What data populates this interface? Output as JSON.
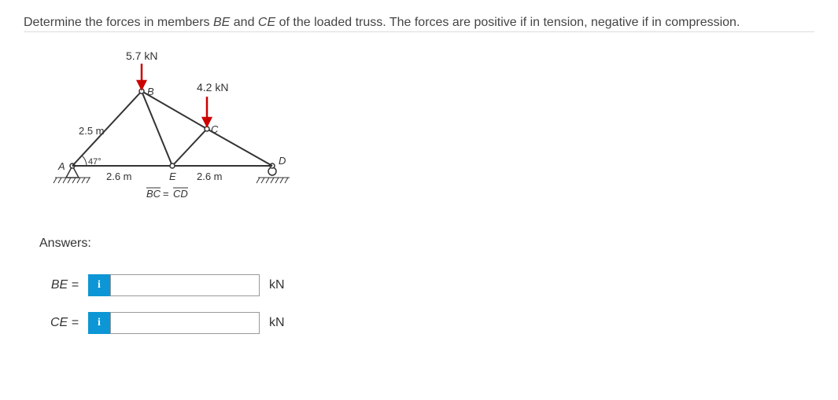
{
  "problem": {
    "text_prefix": "Determine the forces in members ",
    "member1": "BE",
    "text_mid1": " and ",
    "member2": "CE",
    "text_suffix": " of the loaded truss. The forces are positive if in tension, negative if in compression."
  },
  "diagram": {
    "force1_label": "5.7 kN",
    "force2_label": "4.2 kN",
    "length_AB": "2.5 m",
    "angle_A": "47°",
    "length_AE": "2.6 m",
    "length_ED": "2.6 m",
    "node_A": "A",
    "node_B": "B",
    "node_C": "C",
    "node_D": "D",
    "node_E": "E",
    "constraint": "BC = CD",
    "constraint_left": "BC",
    "constraint_right": "CD"
  },
  "answers": {
    "heading": "Answers:",
    "be_label": "BE =",
    "ce_label": "CE =",
    "unit": "kN",
    "be_value": "",
    "ce_value": ""
  }
}
